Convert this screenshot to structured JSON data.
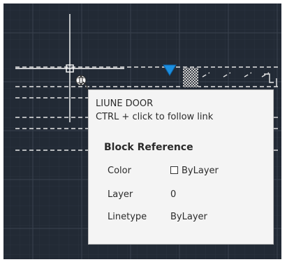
{
  "colors": {
    "canvas_background": "#222a35",
    "grid_minor": "#2a3340",
    "grid_major": "#39424f",
    "line_color": "#e8e8e8",
    "grip_color": "#1b8fe0",
    "tooltip_background": "#f4f4f4",
    "tooltip_text": "#2b2b2b"
  },
  "icons": {
    "hyperlink_cursor": "globe-link-icon",
    "grip": "blue-triangle-grip-icon"
  },
  "tooltip": {
    "title": "LIUNE DOOR",
    "hint": "CTRL + click to follow link",
    "section_title": "Block Reference",
    "properties": [
      {
        "key": "Color",
        "value": "ByLayer"
      },
      {
        "key": "Layer",
        "value": "0"
      },
      {
        "key": "Linetype",
        "value": "ByLayer"
      }
    ]
  }
}
